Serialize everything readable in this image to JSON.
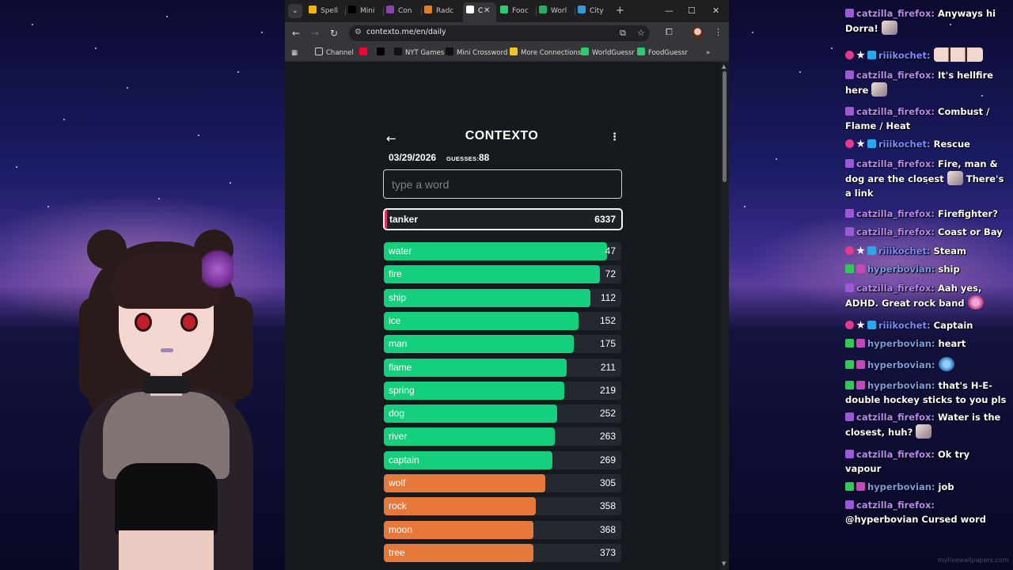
{
  "browser": {
    "tabs": [
      {
        "label": "Spell",
        "color": "#f4b400"
      },
      {
        "label": "Mini",
        "color": "#000000"
      },
      {
        "label": "Con",
        "color": "#8e44ad"
      },
      {
        "label": "Radc",
        "color": "#e67e22"
      },
      {
        "label": "C",
        "color": "#ffffff"
      },
      {
        "label": "Fooc",
        "color": "#2ecc71"
      },
      {
        "label": "Worl",
        "color": "#27ae60"
      },
      {
        "label": "City",
        "color": "#3498db"
      }
    ],
    "url": "contexto.me/en/daily",
    "bookmarks": [
      {
        "label": "Channel",
        "icon": "folder-icon"
      },
      {
        "label": "",
        "icon": "youtube-icon"
      },
      {
        "label": "",
        "icon": "x-icon"
      },
      {
        "label": "NYT Games",
        "icon": "nyt-icon"
      },
      {
        "label": "Mini Crossword",
        "icon": "nyt-icon"
      },
      {
        "label": "More Connections",
        "icon": "grid-icon"
      },
      {
        "label": "WorldGuessr",
        "icon": "globe-icon"
      },
      {
        "label": "FoodGuessr",
        "icon": "globe-icon"
      }
    ]
  },
  "contexto": {
    "title": "CONTEXTO",
    "date": "03/29/2026",
    "guesses_label": "GUESSES:",
    "guesses": "88",
    "input_placeholder": "type a word",
    "last_guess": {
      "word": "tanker",
      "rank": "6337"
    },
    "guesses_list": [
      {
        "word": "water",
        "rank": "47",
        "color": "#14cf7c",
        "fill": 0.94
      },
      {
        "word": "fire",
        "rank": "72",
        "color": "#14cf7c",
        "fill": 0.91
      },
      {
        "word": "ship",
        "rank": "112",
        "color": "#14cf7c",
        "fill": 0.87
      },
      {
        "word": "ice",
        "rank": "152",
        "color": "#14cf7c",
        "fill": 0.82
      },
      {
        "word": "man",
        "rank": "175",
        "color": "#14cf7c",
        "fill": 0.8
      },
      {
        "word": "flame",
        "rank": "211",
        "color": "#14cf7c",
        "fill": 0.77
      },
      {
        "word": "spring",
        "rank": "219",
        "color": "#14cf7c",
        "fill": 0.76
      },
      {
        "word": "dog",
        "rank": "252",
        "color": "#14cf7c",
        "fill": 0.73
      },
      {
        "word": "river",
        "rank": "263",
        "color": "#14cf7c",
        "fill": 0.72
      },
      {
        "word": "captain",
        "rank": "269",
        "color": "#14cf7c",
        "fill": 0.71
      },
      {
        "word": "wolf",
        "rank": "305",
        "color": "#e6793a",
        "fill": 0.68
      },
      {
        "word": "rock",
        "rank": "358",
        "color": "#e6793a",
        "fill": 0.64
      },
      {
        "word": "moon",
        "rank": "368",
        "color": "#e6793a",
        "fill": 0.63
      },
      {
        "word": "tree",
        "rank": "373",
        "color": "#e6793a",
        "fill": 0.63
      }
    ]
  },
  "chat": [
    {
      "badges": [
        "sub"
      ],
      "user": "catzilla_firefox",
      "ucls": "u-cat",
      "text": "Anyways hi Dorra!",
      "emote": "emote"
    },
    {
      "badges": [
        "heart",
        "star",
        "crown"
      ],
      "user": "riiikochet",
      "ucls": "u-rii",
      "text": "",
      "emote": "emote triple"
    },
    {
      "badges": [
        "sub"
      ],
      "user": "catzilla_firefox",
      "ucls": "u-cat",
      "text": "It's hellfire here",
      "emote": "emote"
    },
    {
      "badges": [
        "sub"
      ],
      "user": "catzilla_firefox",
      "ucls": "u-cat",
      "text": "Combust / Flame / Heat",
      "emote": ""
    },
    {
      "badges": [
        "heart",
        "star",
        "crown"
      ],
      "user": "riiikochet",
      "ucls": "u-rii",
      "text": "Rescue",
      "emote": ""
    },
    {
      "badges": [
        "sub"
      ],
      "user": "catzilla_firefox",
      "ucls": "u-cat",
      "text": "Fire, man & dog are the closest",
      "emote": "emote",
      "text2": "There's a link"
    },
    {
      "badges": [
        "sub"
      ],
      "user": "catzilla_firefox",
      "ucls": "u-cat",
      "text": "Firefighter?",
      "emote": ""
    },
    {
      "badges": [
        "sub"
      ],
      "user": "catzilla_firefox",
      "ucls": "u-cat",
      "text": "Coast or Bay",
      "emote": ""
    },
    {
      "badges": [
        "heart",
        "star",
        "crown"
      ],
      "user": "riiikochet",
      "ucls": "u-rii",
      "text": "Steam",
      "emote": ""
    },
    {
      "badges": [
        "check",
        "vip"
      ],
      "user": "hyperbovian",
      "ucls": "u-hyp",
      "text": "ship",
      "emote": ""
    },
    {
      "badges": [
        "sub"
      ],
      "user": "catzilla_firefox",
      "ucls": "u-cat",
      "text": "Aah yes, ADHD. Great rock band",
      "emote": "emote pink"
    },
    {
      "badges": [
        "heart",
        "star",
        "crown"
      ],
      "user": "riiikochet",
      "ucls": "u-rii",
      "text": "Captain",
      "emote": ""
    },
    {
      "badges": [
        "check",
        "vip"
      ],
      "user": "hyperbovian",
      "ucls": "u-hyp",
      "text": "heart",
      "emote": ""
    },
    {
      "badges": [
        "check",
        "vip"
      ],
      "user": "hyperbovian",
      "ucls": "u-hyp",
      "text": "",
      "emote": "emote blue"
    },
    {
      "badges": [
        "check",
        "vip"
      ],
      "user": "hyperbovian",
      "ucls": "u-hyp",
      "text": "that's H-E-double hockey sticks to you pls",
      "emote": ""
    },
    {
      "badges": [
        "sub"
      ],
      "user": "catzilla_firefox",
      "ucls": "u-cat",
      "text": "Water is the closest, huh?",
      "emote": "emote"
    },
    {
      "badges": [
        "sub"
      ],
      "user": "catzilla_firefox",
      "ucls": "u-cat",
      "text": "Ok try vapour",
      "emote": ""
    },
    {
      "badges": [
        "check",
        "vip"
      ],
      "user": "hyperbovian",
      "ucls": "u-hyp",
      "text": "job",
      "emote": ""
    },
    {
      "badges": [
        "sub"
      ],
      "user": "catzilla_firefox",
      "ucls": "u-cat",
      "text": "@hyperbovian Cursed word",
      "emote": ""
    }
  ],
  "watermark": "mylivewallpapers.com"
}
